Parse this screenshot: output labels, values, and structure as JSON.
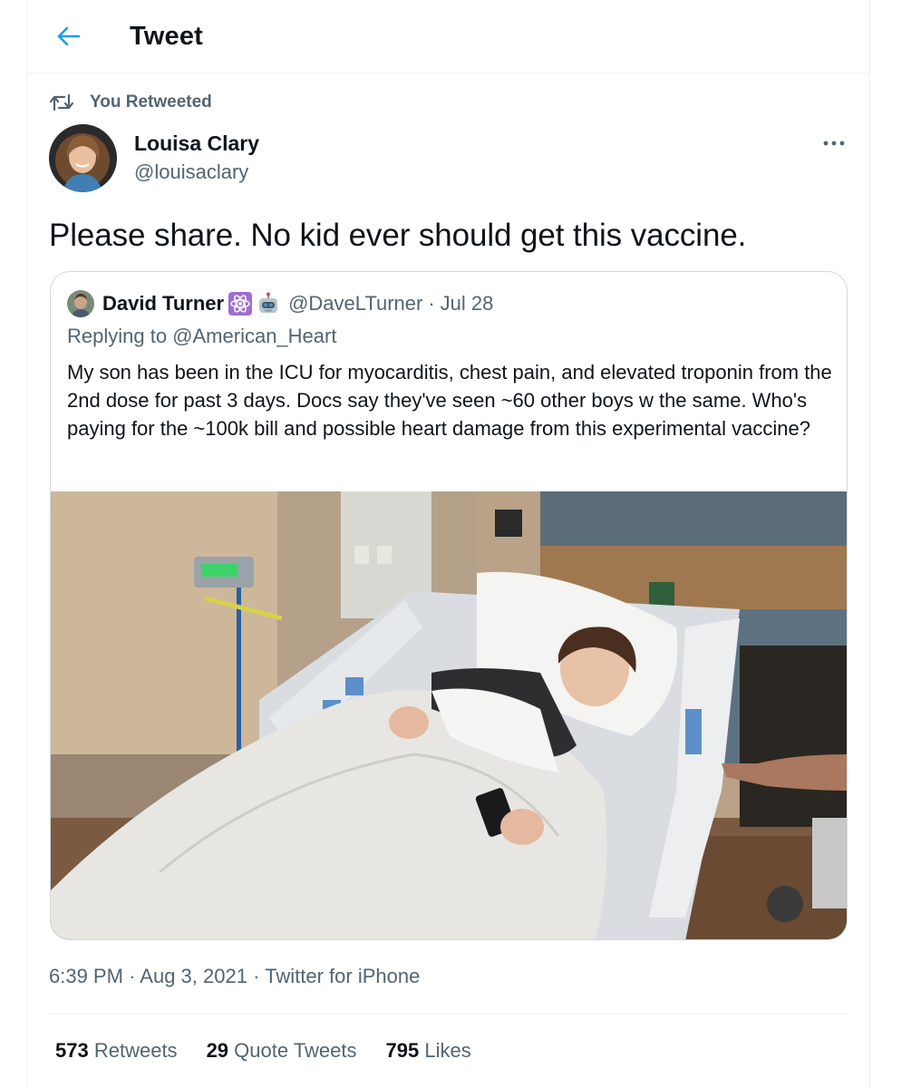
{
  "header": {
    "title": "Tweet"
  },
  "social_context": {
    "label": "You Retweeted"
  },
  "tweet": {
    "author_name": "Louisa Clary",
    "author_handle": "@louisaclary",
    "text": "Please share. No kid ever should get this vaccine.",
    "time": "6:39 PM",
    "date": "Aug 3, 2021",
    "source": "Twitter for iPhone",
    "separator": "·"
  },
  "quote": {
    "author_name": "David Turner",
    "author_handle": "@DaveLTurner",
    "date": "Jul 28",
    "separator": "·",
    "replying_to": "Replying to @American_Heart",
    "text": "My son has been in the ICU for myocarditis, chest pain, and elevated troponin from the 2nd dose for past 3 days. Docs say they've seen ~60 other boys w the same. Who's paying for the ~100k bill and possible heart damage from this experimental vaccine?",
    "emojis": [
      "atom-emoji",
      "robot-emoji"
    ]
  },
  "stats": {
    "retweets_count": "573",
    "retweets_label": "Retweets",
    "quotes_count": "29",
    "quotes_label": "Quote Tweets",
    "likes_count": "795",
    "likes_label": "Likes"
  },
  "colors": {
    "accent": "#1d9bf0",
    "secondary_text": "#536471",
    "primary_text": "#0f1419",
    "border": "#cfd9de"
  },
  "icons": {
    "back": "arrow-left-icon",
    "retweet": "retweet-icon",
    "more": "more-horizontal-icon"
  }
}
